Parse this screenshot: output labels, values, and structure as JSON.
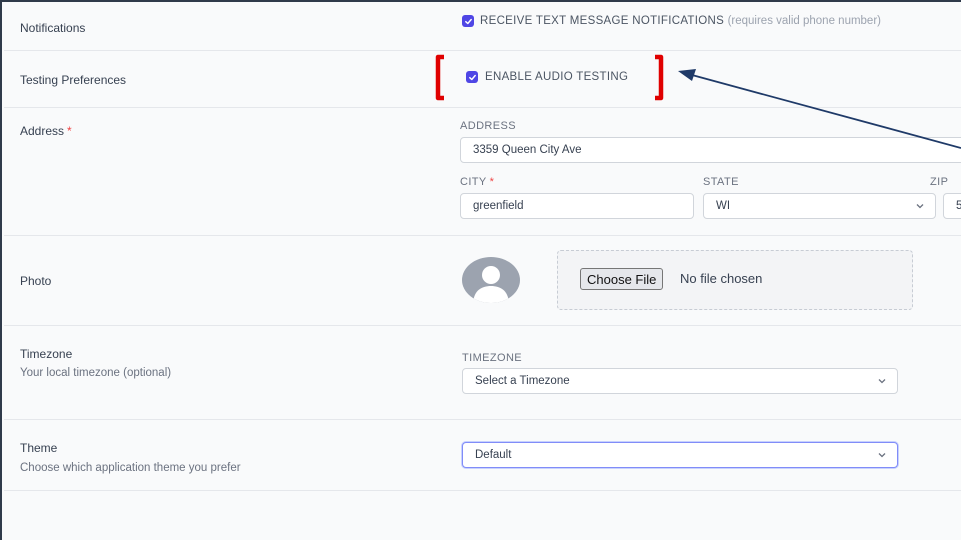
{
  "notifications": {
    "label": "Notifications",
    "checkbox_label": "RECEIVE TEXT MESSAGE NOTIFICATIONS",
    "checkbox_note": "(requires valid phone number)",
    "checked": true
  },
  "testing": {
    "label": "Testing Preferences",
    "checkbox_label": "ENABLE AUDIO TESTING",
    "checked": true
  },
  "address": {
    "label": "Address",
    "required_mark": "*",
    "address_caption": "ADDRESS",
    "address_value": "3359 Queen City Ave",
    "city_caption": "CITY",
    "city_required_mark": "*",
    "city_value": "greenfield",
    "state_caption": "STATE",
    "state_value": "WI",
    "zip_caption": "ZIP",
    "zip_value": "5"
  },
  "photo": {
    "label": "Photo",
    "file_button": "Choose File",
    "file_status": "No file chosen"
  },
  "timezone": {
    "label": "Timezone",
    "description": "Your local timezone (optional)",
    "caption": "TIMEZONE",
    "placeholder": "Select a Timezone"
  },
  "theme": {
    "label": "Theme",
    "description": "Choose which application theme you prefer",
    "value": "Default"
  },
  "colors": {
    "accent": "#4f46e5",
    "annotation_bracket": "#e00000",
    "annotation_arrow": "#1f3a68",
    "required": "#ef4444"
  },
  "icons": {
    "checkbox": "check-icon",
    "select": "chevron-down-icon",
    "avatar": "user-placeholder-icon"
  }
}
